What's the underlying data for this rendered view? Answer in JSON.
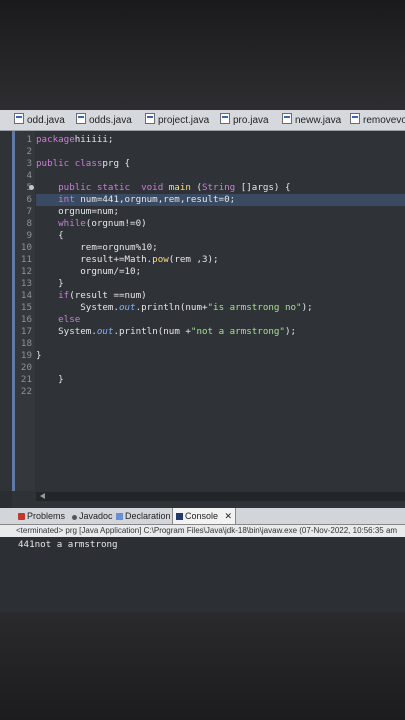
{
  "tabs": [
    "odd.java",
    "odds.java",
    "project.java",
    "pro.java",
    "neww.java",
    "removevow"
  ],
  "code_lines": [
    {
      "n": "1",
      "parts": [
        [
          "kw",
          "package"
        ],
        [
          "",
          "hiiiii;"
        ]
      ]
    },
    {
      "n": "2",
      "parts": []
    },
    {
      "n": "3",
      "parts": [
        [
          "kw",
          "public class"
        ],
        [
          "",
          "prg {"
        ]
      ]
    },
    {
      "n": "4",
      "parts": []
    },
    {
      "n": "5",
      "fold": true,
      "parts": [
        [
          "kw",
          "    public static  void"
        ],
        [
          "mt",
          " main"
        ],
        [
          "",
          " ("
        ],
        [
          "ty",
          "String"
        ],
        [
          "",
          " []args) {"
        ]
      ]
    },
    {
      "n": "6",
      "hl": true,
      "parts": [
        [
          "ty",
          "    int"
        ],
        [
          "",
          " num=441,orgnum,rem,result=0;"
        ]
      ]
    },
    {
      "n": "7",
      "parts": [
        [
          "",
          "    orgnum=num;"
        ]
      ]
    },
    {
      "n": "8",
      "parts": [
        [
          "kw",
          "    while"
        ],
        [
          "",
          "(orgnum!=0)"
        ]
      ]
    },
    {
      "n": "9",
      "parts": [
        [
          "",
          "    {"
        ]
      ]
    },
    {
      "n": "10",
      "parts": [
        [
          "",
          "        rem=orgnum%10;"
        ]
      ]
    },
    {
      "n": "11",
      "parts": [
        [
          "",
          "        result+=Math."
        ],
        [
          "mt",
          "pow"
        ],
        [
          "",
          "(rem ,3);"
        ]
      ]
    },
    {
      "n": "12",
      "parts": [
        [
          "",
          "        orgnum/=10;"
        ]
      ]
    },
    {
      "n": "13",
      "parts": [
        [
          "",
          "    }"
        ]
      ]
    },
    {
      "n": "14",
      "parts": [
        [
          "kw",
          "    if"
        ],
        [
          "",
          "(result ==num)"
        ]
      ]
    },
    {
      "n": "15",
      "parts": [
        [
          "",
          "        System."
        ],
        [
          "fd",
          "out"
        ],
        [
          "",
          ".println(num+"
        ],
        [
          "st",
          "\"is armstrong no\""
        ],
        [
          "",
          ");"
        ]
      ]
    },
    {
      "n": "16",
      "parts": [
        [
          "kw",
          "    else"
        ]
      ]
    },
    {
      "n": "17",
      "parts": [
        [
          "",
          "    System."
        ],
        [
          "fd",
          "out"
        ],
        [
          "",
          ".println(num +"
        ],
        [
          "st",
          "\"not a armstrong\""
        ],
        [
          "",
          ");"
        ]
      ]
    },
    {
      "n": "18",
      "parts": []
    },
    {
      "n": "19",
      "parts": [
        [
          "",
          "}"
        ]
      ]
    },
    {
      "n": "20",
      "parts": []
    },
    {
      "n": "21",
      "parts": [
        [
          "",
          "    }"
        ]
      ]
    },
    {
      "n": "22",
      "parts": []
    }
  ],
  "panel_tabs": {
    "problems": "Problems",
    "javadoc": "Javadoc",
    "declaration": "Declaration",
    "console": "Console",
    "close": "✕"
  },
  "console_path": "<terminated> prg [Java Application] C:\\Program Files\\Java\\jdk-18\\bin\\javaw.exe  (07-Nov-2022, 10:56:35 am",
  "console_output": "441not a armstrong"
}
